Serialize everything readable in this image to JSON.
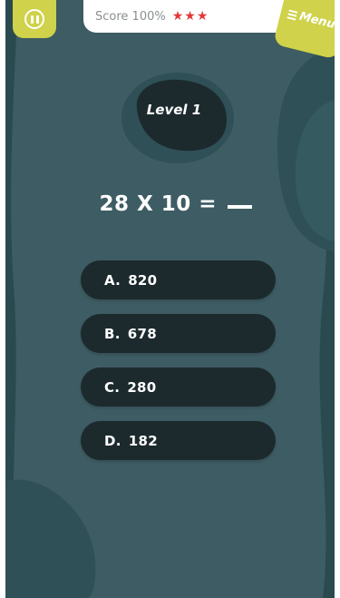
{
  "score": {
    "label": "Score 100%",
    "stars": [
      "★",
      "★",
      "★"
    ],
    "star_color": "#e2373b"
  },
  "menu": {
    "label": "Menu",
    "icon": "hamburger-icon"
  },
  "pause": {
    "icon": "pause-icon"
  },
  "level": {
    "label": "Level 1"
  },
  "question": {
    "text": "28 X 10 ="
  },
  "answers": [
    {
      "letter": "A.",
      "value": "820"
    },
    {
      "letter": "B.",
      "value": "678"
    },
    {
      "letter": "C.",
      "value": "280"
    },
    {
      "letter": "D.",
      "value": "182"
    }
  ],
  "colors": {
    "background": "#3e5c63",
    "accent": "#cfd24a",
    "answer_button": "#1c2a2e",
    "dark_blob": "#2a4a50"
  }
}
